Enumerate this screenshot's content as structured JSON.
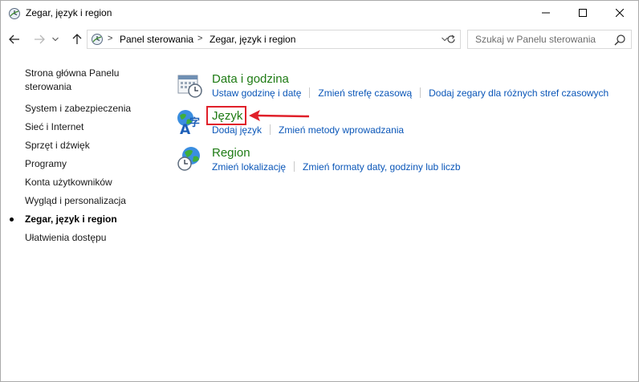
{
  "window": {
    "title": "Zegar, język i region",
    "controls": {
      "minimize": "minimize",
      "maximize": "maximize",
      "close": "close"
    }
  },
  "address": {
    "separator": ">",
    "crumbs": [
      "Panel sterowania",
      "Zegar, język i region"
    ]
  },
  "search": {
    "placeholder": "Szukaj w Panelu sterowania"
  },
  "sidebar": {
    "items": [
      {
        "label": "Strona główna Panelu",
        "label2": "sterowania"
      },
      {
        "label": "System i zabezpieczenia"
      },
      {
        "label": "Sieć i Internet"
      },
      {
        "label": "Sprzęt i dźwięk"
      },
      {
        "label": "Programy"
      },
      {
        "label": "Konta użytkowników"
      },
      {
        "label": "Wygląd i personalizacja"
      },
      {
        "label": "Zegar, język i region",
        "current": true
      },
      {
        "label": "Ułatwienia dostępu"
      }
    ]
  },
  "categories": [
    {
      "title": "Data i godzina",
      "icon": "calendar-clock-icon",
      "links": [
        "Ustaw godzinę i datę",
        "Zmień strefę czasową",
        "Dodaj zegary dla różnych stref czasowych"
      ]
    },
    {
      "title": "Język",
      "icon": "globe-language-icon",
      "links": [
        "Dodaj język",
        "Zmień metody wprowadzania"
      ]
    },
    {
      "title": "Region",
      "icon": "globe-clock-icon",
      "links": [
        "Zmień lokalizację",
        "Zmień formaty daty, godziny lub liczb"
      ]
    }
  ],
  "colors": {
    "category_title": "#1e7b14",
    "link": "#0a56b8",
    "highlight": "#e0202a"
  }
}
